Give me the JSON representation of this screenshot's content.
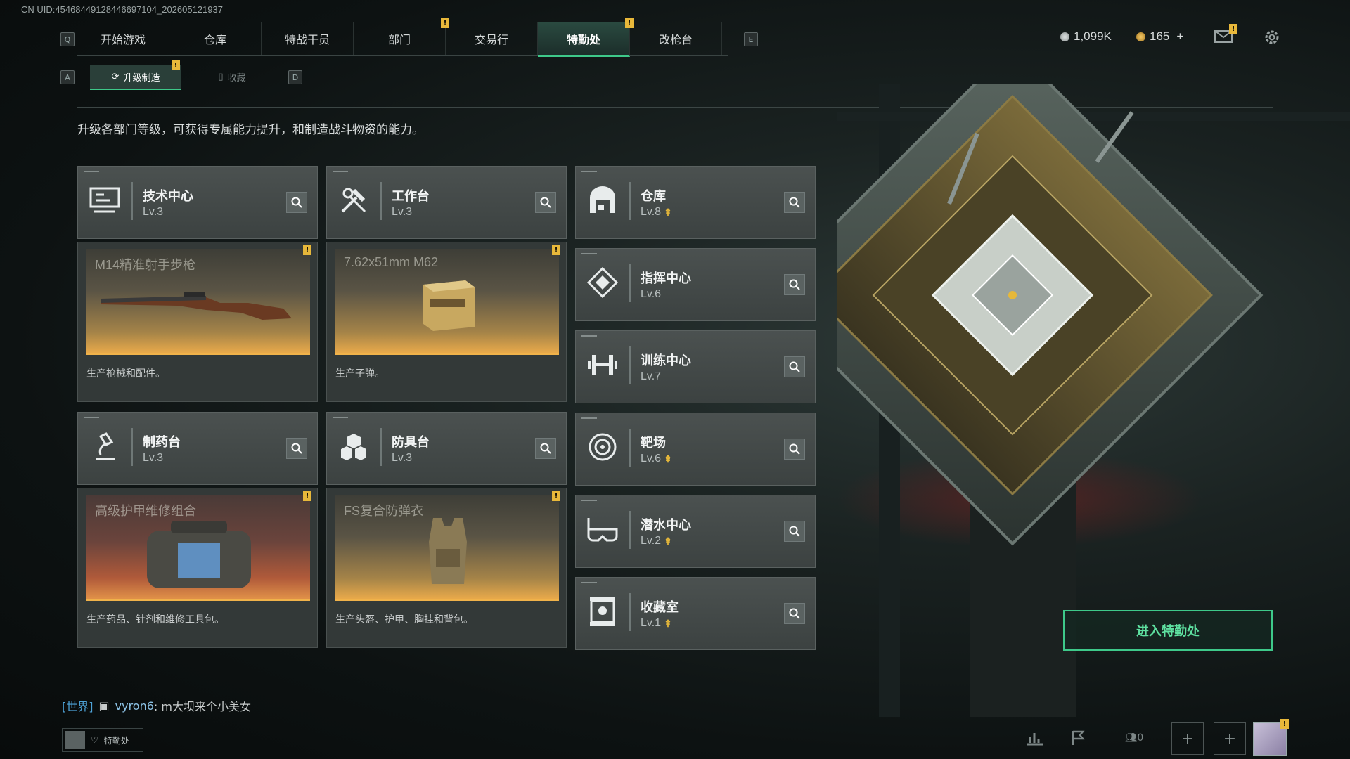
{
  "uid": "CN UID:45468449128446697104_202605121937",
  "nav": {
    "left_key": "Q",
    "right_key": "E",
    "tabs": [
      {
        "label": "开始游戏",
        "active": false,
        "badge": false
      },
      {
        "label": "仓库",
        "active": false,
        "badge": false
      },
      {
        "label": "特战干员",
        "active": false,
        "badge": false
      },
      {
        "label": "部门",
        "active": false,
        "badge": true
      },
      {
        "label": "交易行",
        "active": false,
        "badge": false
      },
      {
        "label": "特勤处",
        "active": true,
        "badge": true
      },
      {
        "label": "改枪台",
        "active": false,
        "badge": false
      }
    ]
  },
  "currency": {
    "silver": "1,099K",
    "gold": "165",
    "gold_add": "+"
  },
  "badge_text": "!",
  "subtabs": {
    "left_key": "A",
    "right_key": "D",
    "upgrade": "升级制造",
    "collect": "收藏"
  },
  "description": "升级各部门等级，可获得专属能力提升，和制造战斗物资的能力。",
  "cards": {
    "tech": {
      "name": "技术中心",
      "level": "Lv.3"
    },
    "workbench": {
      "name": "工作台",
      "level": "Lv.3"
    },
    "pharmacy": {
      "name": "制药台",
      "level": "Lv.3"
    },
    "armor": {
      "name": "防具台",
      "level": "Lv.3"
    },
    "warehouse": {
      "name": "仓库",
      "level": "Lv.8"
    },
    "command": {
      "name": "指挥中心",
      "level": "Lv.6"
    },
    "training": {
      "name": "训练中心",
      "level": "Lv.7"
    },
    "range": {
      "name": "靶场",
      "level": "Lv.6"
    },
    "diving": {
      "name": "潜水中心",
      "level": "Lv.2"
    },
    "collection": {
      "name": "收藏室",
      "level": "Lv.1"
    }
  },
  "production": {
    "tech": {
      "item": "M14精准射手步枪",
      "desc": "生产枪械和配件。"
    },
    "workbench": {
      "item": "7.62x51mm M62",
      "desc": "生产子弹。"
    },
    "pharmacy": {
      "item": "高级护甲维修组合",
      "desc": "生产药品、针剂和维修工具包。"
    },
    "armor": {
      "item": "FS复合防弹衣",
      "desc": "生产头盔、护甲、胸挂和背包。"
    }
  },
  "enter_button": "进入特勤处",
  "chat": {
    "channel": "[世界]",
    "user": "vyron6",
    "message": ": m大坝来个小美女"
  },
  "bottom": {
    "status_label": "特勤处",
    "friends_count": "0",
    "plus": "+"
  },
  "colors": {
    "accent_green": "#3ec98a",
    "badge_yellow": "#e8b83a",
    "upgrade_arrow": "#e6b83a"
  }
}
